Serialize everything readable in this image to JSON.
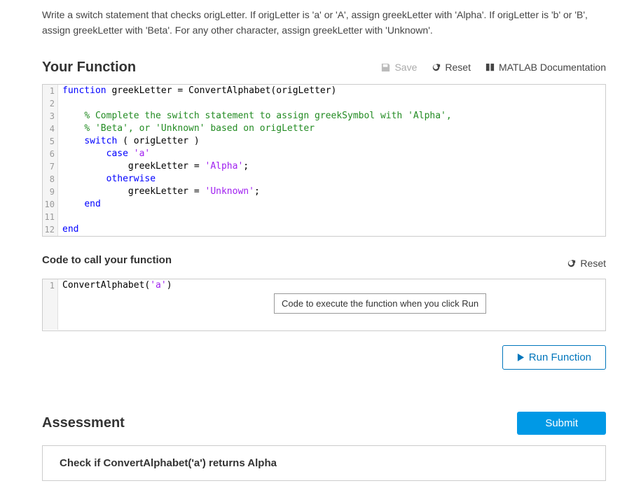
{
  "instructions": "Write a switch statement that checks origLetter. If origLetter is 'a' or 'A', assign greekLetter with 'Alpha'. If origLetter is 'b' or 'B', assign greekLetter with 'Beta'. For any other character, assign greekLetter with 'Unknown'.",
  "header": {
    "title": "Your Function",
    "save": "Save",
    "reset": "Reset",
    "docs": "MATLAB Documentation"
  },
  "code": {
    "lines": [
      {
        "n": "1",
        "segs": [
          [
            "kw",
            "function"
          ],
          [
            "fn",
            " greekLetter = ConvertAlphabet(origLetter)"
          ]
        ]
      },
      {
        "n": "2",
        "segs": []
      },
      {
        "n": "3",
        "segs": [
          [
            "fn",
            "    "
          ],
          [
            "com",
            "% Complete the switch statement to assign greekSymbol with 'Alpha',"
          ]
        ]
      },
      {
        "n": "4",
        "segs": [
          [
            "fn",
            "    "
          ],
          [
            "com",
            "% 'Beta', or 'Unknown' based on origLetter"
          ]
        ]
      },
      {
        "n": "5",
        "segs": [
          [
            "fn",
            "    "
          ],
          [
            "kw",
            "switch"
          ],
          [
            "fn",
            " ( origLetter )"
          ]
        ]
      },
      {
        "n": "6",
        "segs": [
          [
            "fn",
            "        "
          ],
          [
            "kw",
            "case"
          ],
          [
            "fn",
            " "
          ],
          [
            "str",
            "'a'"
          ]
        ]
      },
      {
        "n": "7",
        "segs": [
          [
            "fn",
            "            greekLetter = "
          ],
          [
            "str",
            "'Alpha'"
          ],
          [
            "fn",
            ";"
          ]
        ]
      },
      {
        "n": "8",
        "segs": [
          [
            "fn",
            "        "
          ],
          [
            "kw",
            "otherwise"
          ]
        ]
      },
      {
        "n": "9",
        "segs": [
          [
            "fn",
            "            greekLetter = "
          ],
          [
            "str",
            "'Unknown'"
          ],
          [
            "fn",
            ";"
          ]
        ]
      },
      {
        "n": "10",
        "segs": [
          [
            "fn",
            "    "
          ],
          [
            "kw",
            "end"
          ]
        ]
      },
      {
        "n": "11",
        "segs": []
      },
      {
        "n": "12",
        "segs": [
          [
            "kw",
            "end"
          ]
        ]
      }
    ]
  },
  "callsection": {
    "title": "Code to call your function",
    "reset": "Reset",
    "line_no": "1",
    "line_text": "ConvertAlphabet('a')",
    "tooltip": "Code to execute the function when you click Run"
  },
  "run_button": "Run Function",
  "assessment": {
    "title": "Assessment",
    "submit": "Submit",
    "check": "Check if ConvertAlphabet('a') returns Alpha"
  }
}
